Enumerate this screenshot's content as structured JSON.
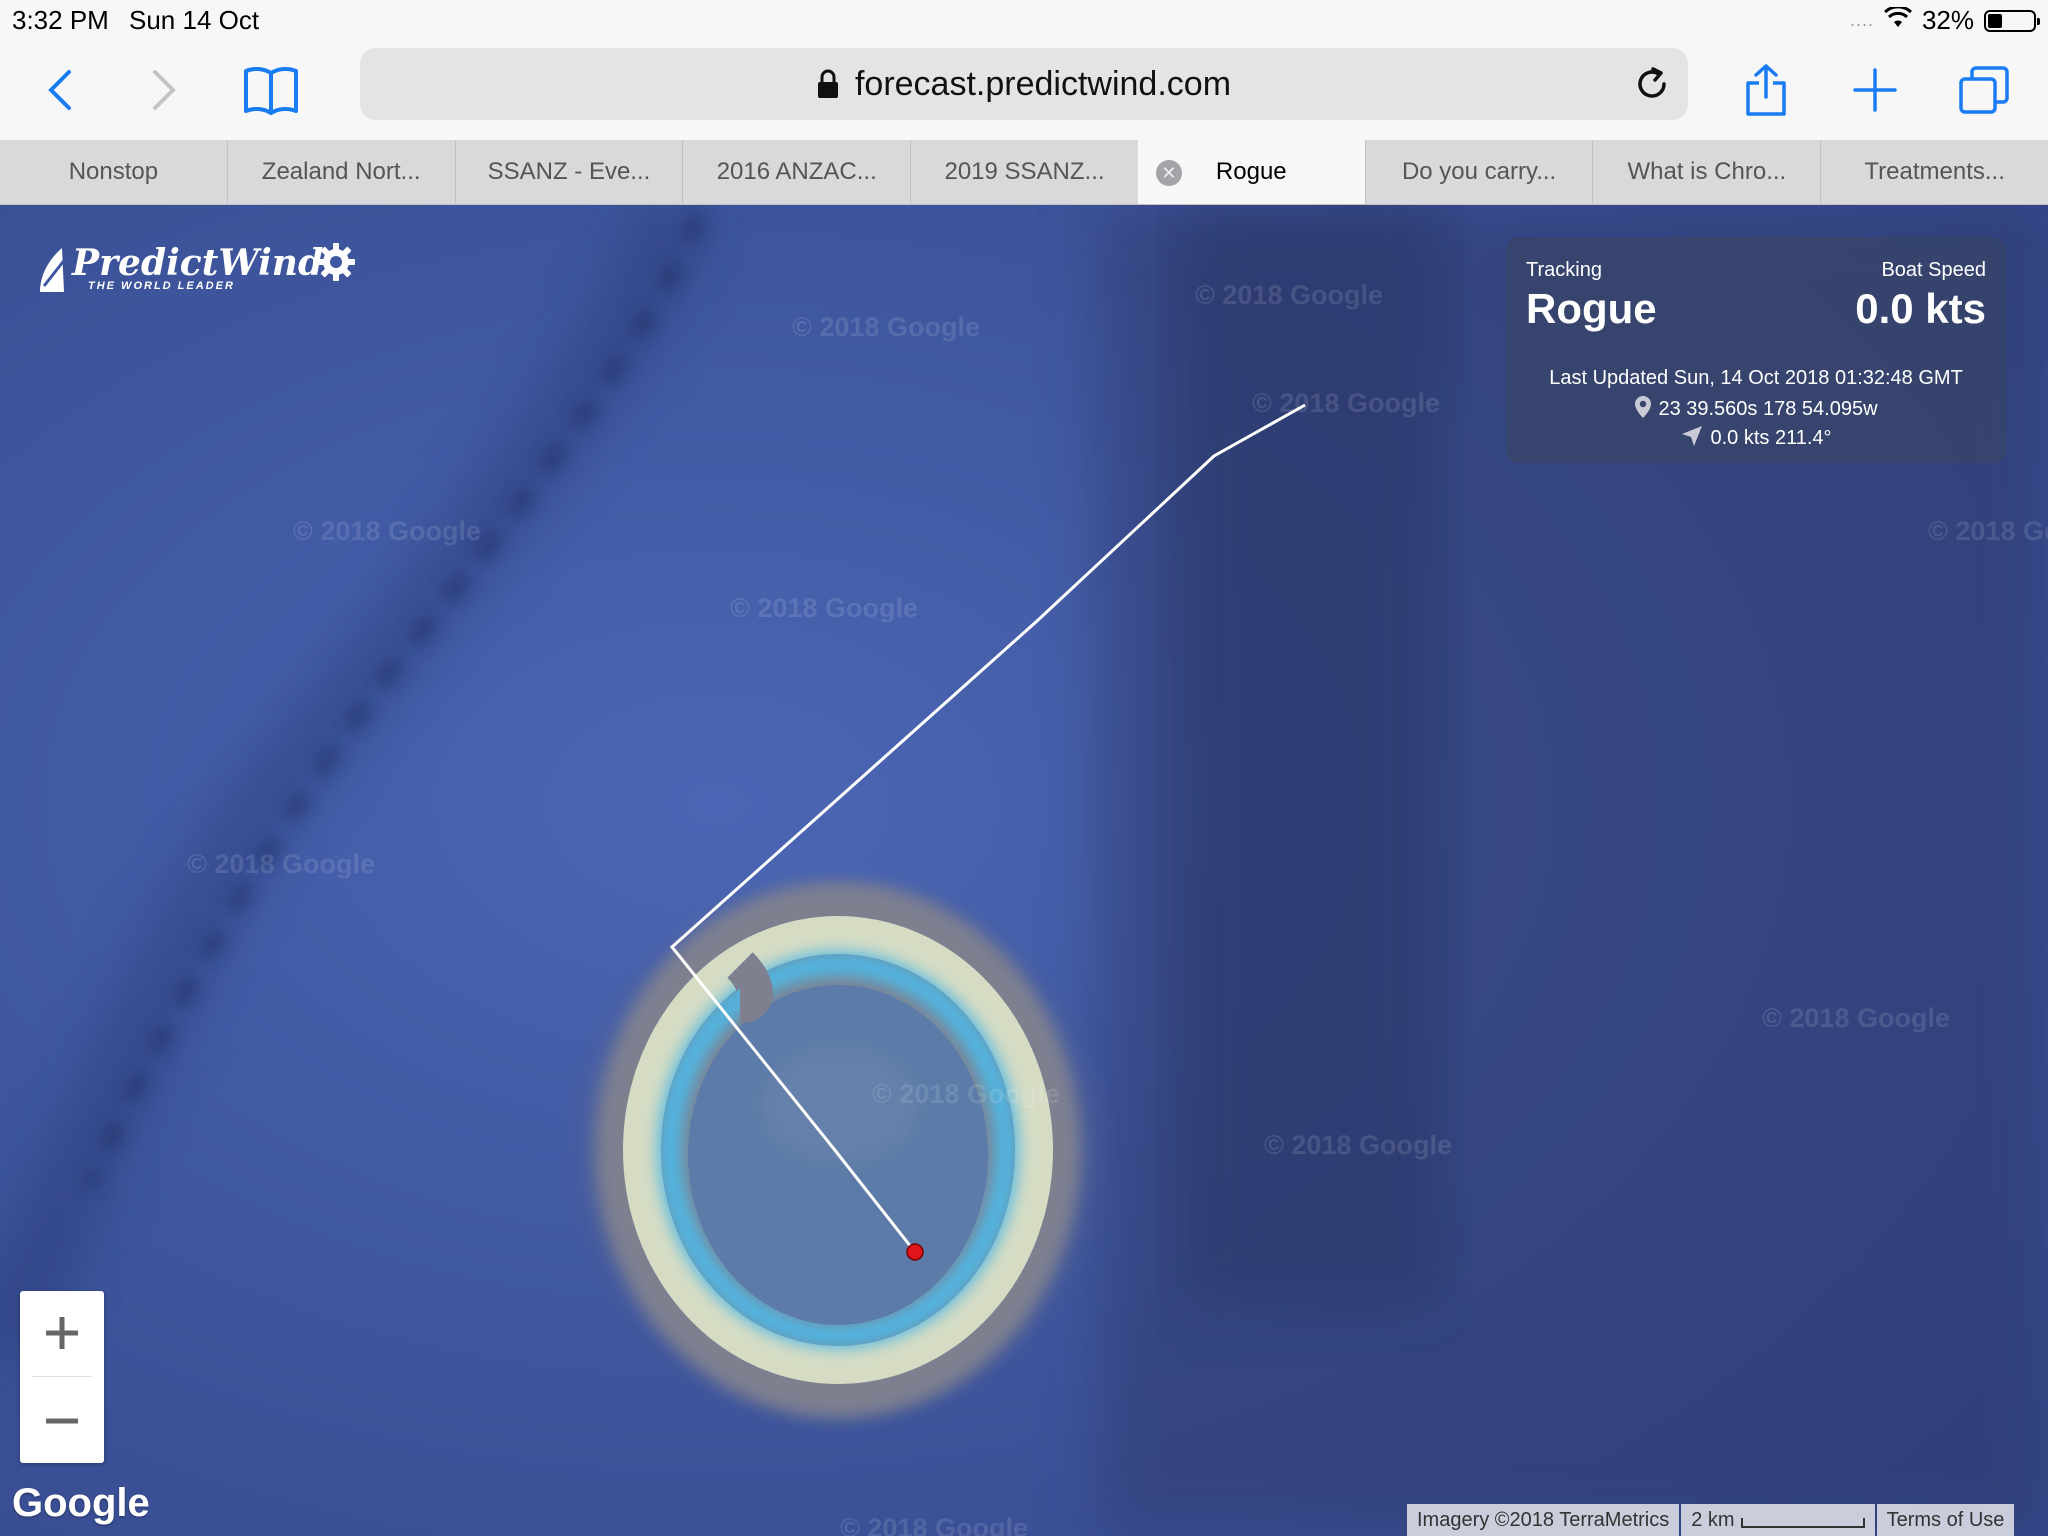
{
  "status_bar": {
    "time": "3:32 PM",
    "date": "Sun 14 Oct",
    "signal_dots": "....",
    "battery_percent": "32%",
    "battery_level": 0.32
  },
  "toolbar": {
    "url": "forecast.predictwind.com",
    "accent_color": "#1a7cf2"
  },
  "tabs": [
    {
      "label": "Nonstop"
    },
    {
      "label": "Zealand Nort..."
    },
    {
      "label": "SSANZ - Eve..."
    },
    {
      "label": "2016 ANZAC..."
    },
    {
      "label": "2019 SSANZ..."
    },
    {
      "label": "Rogue",
      "active": true
    },
    {
      "label": "Do you carry..."
    },
    {
      "label": "What is Chro..."
    },
    {
      "label": "Treatments..."
    }
  ],
  "map": {
    "logo_brand": "PredictWind",
    "logo_tagline": "THE WORLD LEADER",
    "watermark_text": "© 2018 Google",
    "google_logo": "Google",
    "tracking_panel": {
      "tracking_label": "Tracking",
      "boat_name": "Rogue",
      "speed_label": "Boat Speed",
      "speed_value": "0.0 kts",
      "last_updated": "Last Updated Sun, 14 Oct 2018 01:32:48 GMT",
      "position": "23 39.560s 178 54.095w",
      "heading": "0.0 kts 211.4°"
    },
    "zoom": {
      "in_icon": "plus-icon",
      "out_icon": "minus-icon"
    },
    "attribution": {
      "imagery": "Imagery ©2018 TerraMetrics",
      "scale": "2 km",
      "terms": "Terms of Use"
    }
  }
}
